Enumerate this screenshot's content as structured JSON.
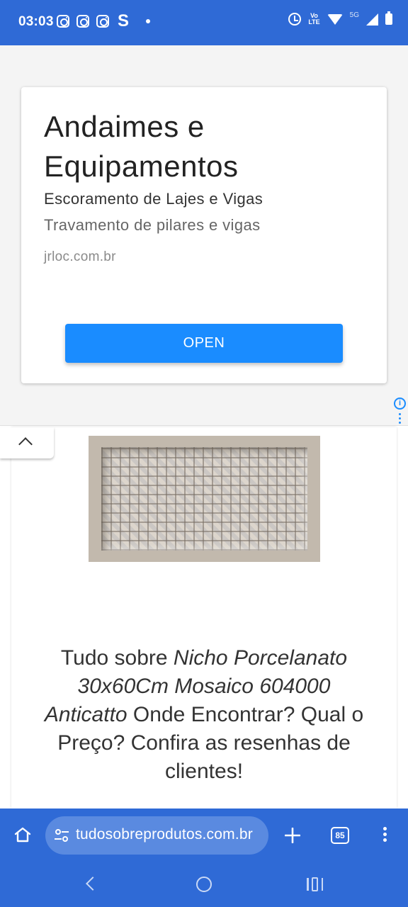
{
  "status_bar": {
    "time": "03:03",
    "s_glyph": "S",
    "volte_top": "Vo",
    "volte_bottom": "LTE",
    "network": "5G"
  },
  "ad": {
    "title": "Andaimes e Equipamentos",
    "subtitle": "Escoramento de Lajes e Vigas",
    "description": "Travamento de pilares e vigas",
    "domain": "jrloc.com.br",
    "cta_label": "OPEN",
    "info_glyph": "i"
  },
  "article": {
    "image_alt": "Nicho Porcelanato 30x60Cm Mosaico 604000 Anticatto",
    "headline_prefix": "Tudo sobre ",
    "headline_product": "Nicho Porcelanato 30x60Cm Mosaico 604000 Anticatto",
    "headline_suffix": " Onde Encontrar? Qual o Preço? Confira as resenhas de clientes!"
  },
  "browser": {
    "url": "tudosobreprodutos.com.br",
    "tab_count": "85"
  },
  "colors": {
    "system_blue": "#2f6ad6",
    "ad_button": "#1a8cff"
  },
  "icons": [
    "instagram-icon",
    "alarm-icon",
    "wifi-icon",
    "signal-icon",
    "battery-icon",
    "adchoices-icon",
    "chevron-up-icon",
    "home-icon",
    "site-settings-icon",
    "plus-icon",
    "tabs-icon",
    "more-vert-icon",
    "back-icon",
    "home-circle-icon",
    "recents-icon"
  ]
}
